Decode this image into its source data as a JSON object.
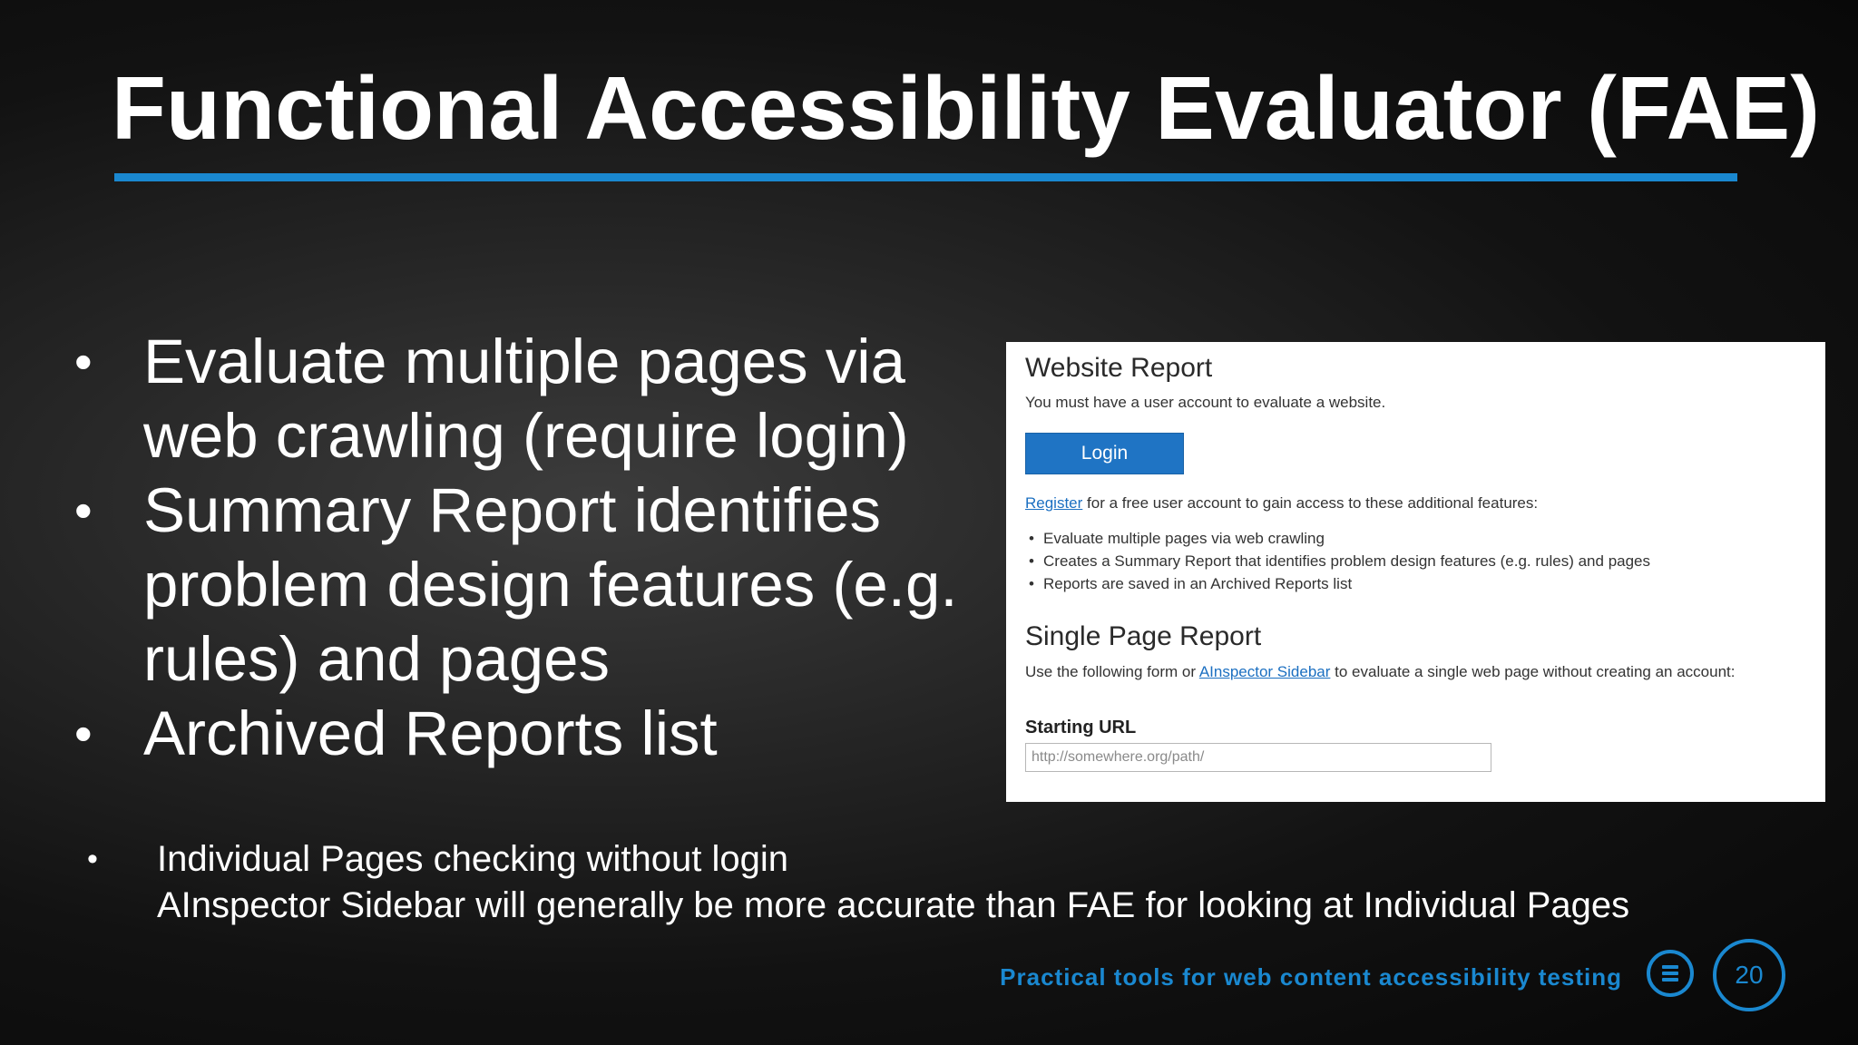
{
  "slide": {
    "title": "Functional Accessibility Evaluator (FAE)",
    "bullets": [
      {
        "line1": "Evaluate multiple pages via",
        "line2": "web crawling (require login)"
      },
      {
        "line1": "Summary Report identifies",
        "line2": "problem design features (e.g.",
        "line3": "rules) and pages"
      },
      {
        "line1": "Archived Reports list"
      }
    ],
    "bullet_symbol": "•",
    "note": {
      "line1": "Individual Pages checking without login",
      "line2": "AInspector Sidebar will generally be more accurate than FAE for looking at Individual Pages"
    },
    "footer_text": "Practical tools for web content accessibility testing",
    "page_number": "20",
    "accent_color": "#1a88d0"
  },
  "screenshot": {
    "website_report": {
      "heading": "Website Report",
      "notice": "You must have a user account to evaluate a website.",
      "login_label": "Login",
      "register_link": "Register",
      "register_text": " for a free user account to gain access to these additional features:",
      "features": [
        "Evaluate multiple pages via web crawling",
        "Creates a Summary Report that identifies problem design features (e.g. rules) and pages",
        "Reports are saved in an Archived Reports list"
      ]
    },
    "single_page_report": {
      "heading": "Single Page Report",
      "text_before": "Use the following form or ",
      "sidebar_link": "AInspector Sidebar",
      "text_after": " to evaluate a single web page without creating an account:",
      "url_label": "Starting URL",
      "url_placeholder": "http://somewhere.org/path/"
    },
    "button_color": "#1f74c4"
  }
}
